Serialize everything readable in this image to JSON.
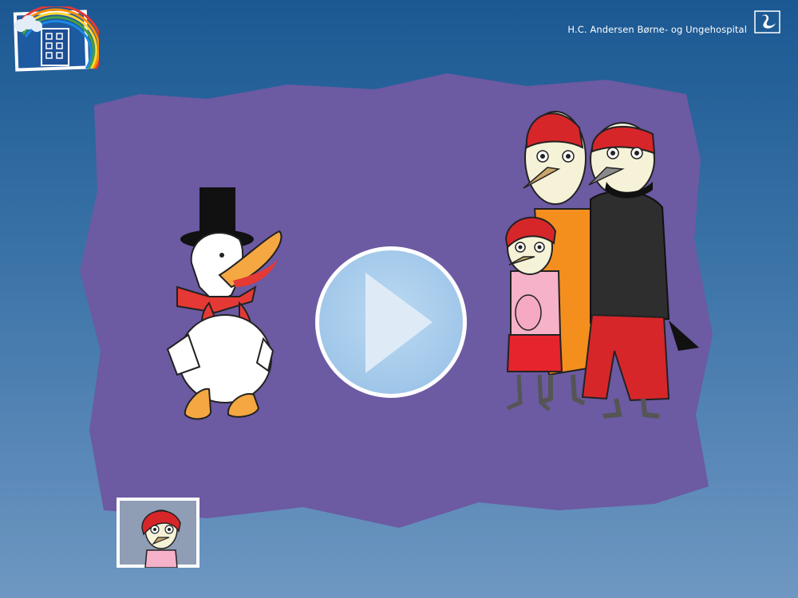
{
  "header": {
    "hospital_name": "H.C. Andersen Børne- og Ungehospital",
    "logo_icon": "hospital-building-rainbow-icon",
    "swan_icon": "swan-logo-icon"
  },
  "player": {
    "play_icon": "play-icon",
    "characters": [
      "duck-with-top-hat",
      "woodpecker-family"
    ]
  },
  "thumbnail": {
    "icon": "girl-bird-avatar"
  },
  "colors": {
    "background_top": "#1b5892",
    "background_bottom": "#6f97c2",
    "panel": "#6c5aa2",
    "play_fill": "#a7cdec"
  }
}
